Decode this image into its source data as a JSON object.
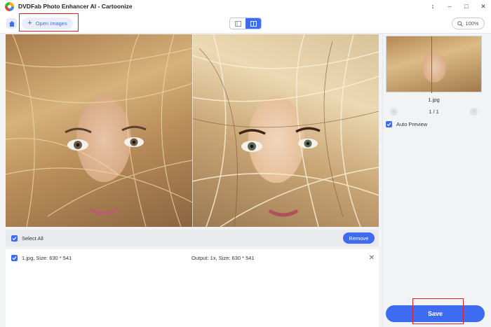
{
  "window": {
    "title": "DVDFab Photo Enhancer AI - Cartoonize",
    "pin_icon": "↕",
    "minimize_icon": "–",
    "maximize_icon": "□",
    "close_icon": "✕"
  },
  "toolbar": {
    "open_images_label": "Open Images",
    "zoom_value": "100%"
  },
  "file_list": {
    "select_all_label": "Select All",
    "remove_label": "Remove",
    "rows": [
      {
        "name": "1.jpg, Size: 630 * 541",
        "output": "Output: 1x, Size: 630 * 541"
      }
    ]
  },
  "sidebar": {
    "thumbnail_name": "1.jpg",
    "page_indicator": "1 / 1",
    "auto_preview_label": "Auto Preview",
    "save_label": "Save"
  },
  "colors": {
    "accent": "#3d6cf2",
    "highlight": "#d9222a"
  }
}
